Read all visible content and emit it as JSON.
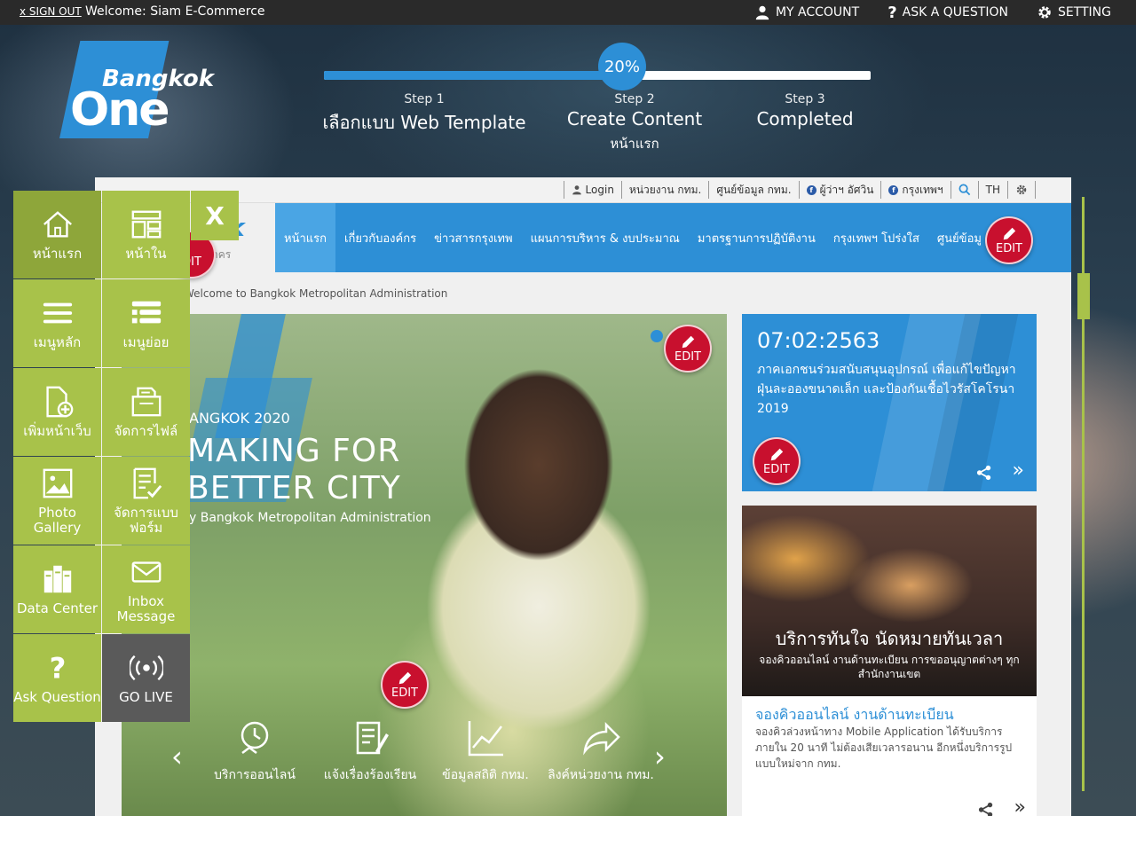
{
  "topbar": {
    "signout": "x SIGN OUT",
    "welcome": "Welcome: Siam E-Commerce",
    "my_account": "MY ACCOUNT",
    "ask_question": "ASK A QUESTION",
    "setting": "SETTING"
  },
  "logo": {
    "line1": "Bangkok",
    "line2": "One"
  },
  "progress": {
    "percent_label": "20%",
    "fill_fraction": 0.55,
    "steps": [
      {
        "number": "Step 1",
        "label": "เลือกแบบ Web Template",
        "sub": ""
      },
      {
        "number": "Step 2",
        "label": "Create Content",
        "sub": "หน้าแรก"
      },
      {
        "number": "Step 3",
        "label": "Completed",
        "sub": ""
      }
    ]
  },
  "preview": {
    "util": {
      "login": "Login",
      "agency": "หน่วยงาน กทม.",
      "datacenter": "ศูนย์ข้อมูล กทม.",
      "fb1": "ผู้ว่าฯ อัศวิน",
      "fb2": "กรุงเทพฯ",
      "lang": "TH"
    },
    "brand": {
      "partial": "k",
      "sub": "าคร"
    },
    "nav": [
      "หน้าแรก",
      "เกี่ยวกับองค์กร",
      "ข่าวสารกรุงเทพ",
      "แผนการบริหาร & งบประมาณ",
      "มาตรฐานการปฏิบัติงาน",
      "กรุงเทพฯ โปร่งใส",
      "ศูนย์ข้อมู"
    ],
    "breadcrumb": "Welcome to Bangkok Metropolitan Administration",
    "hero": {
      "small": "ANGKOK 2020",
      "big1": "MAKING FOR",
      "big2": "BETTER CITY",
      "by": "y Bangkok Metropolitan Administration",
      "icons": [
        {
          "label": "บริการออนไลน์",
          "icon": "clock-hand-icon"
        },
        {
          "label": "แจ้งเรื่องร้องเรียน",
          "icon": "document-pen-icon"
        },
        {
          "label": "ข้อมูลสถิติ กทม.",
          "icon": "line-chart-icon"
        },
        {
          "label": "ลิงค์หน่วยงาน กทม.",
          "icon": "share-arrow-icon"
        }
      ],
      "prev": "‹",
      "next": "›"
    },
    "news": {
      "date": "07:02:2563",
      "body": "ภาคเอกชนร่วมสนับสนุนอุปกรณ์ เพื่อแก้ไขปัญหาฝุ่นละอองขนาดเล็ก และป้องกันเชื้อไวรัสโคโรนา 2019",
      "more": "»"
    },
    "service": {
      "overlay_title": "บริการทันใจ นัดหมายทันเวลา",
      "overlay_sub": "จองคิวออนไลน์ งานด้านทะเบียน การขออนุญาตต่างๆ ทุกสำนักงานเขต",
      "title": "จองคิวออนไลน์ งานด้านทะเบียน",
      "desc": "จองคิวล่วงหน้าทาง Mobile Application ได้รับบริการภายใน 20 นาที ไม่ต้องเสียเวลารอนาน อีกหนึ่งบริการรูปแบบใหม่จาก กทม.",
      "more": "»"
    },
    "edit_label": "EDIT",
    "edit_partial": "DIT"
  },
  "panel": {
    "close": "X",
    "tiles": [
      {
        "label": "หน้าแรก",
        "icon": "home-icon"
      },
      {
        "label": "หน้าใน",
        "icon": "layout-icon"
      },
      {
        "label": "เมนูหลัก",
        "icon": "hamburger-icon"
      },
      {
        "label": "เมนูย่อย",
        "icon": "submenu-icon"
      },
      {
        "label": "เพิ่มหน้าเว็บ",
        "icon": "add-page-icon"
      },
      {
        "label": "จัดการไฟล์",
        "icon": "folder-icon"
      },
      {
        "label": "Photo Gallery",
        "icon": "image-icon"
      },
      {
        "label": "จัดการแบบฟอร์ม",
        "icon": "form-icon"
      },
      {
        "label": "Data Center",
        "icon": "database-icon"
      },
      {
        "label": "Inbox Message",
        "icon": "envelope-icon"
      },
      {
        "label": "Ask Question",
        "icon": "question-icon"
      },
      {
        "label": "GO LIVE",
        "icon": "broadcast-icon"
      }
    ]
  },
  "colors": {
    "accent": "#2d8fd6",
    "menu": "#a8c24a",
    "edit": "#c8102e",
    "dark_tile": "#5a5a5a"
  }
}
